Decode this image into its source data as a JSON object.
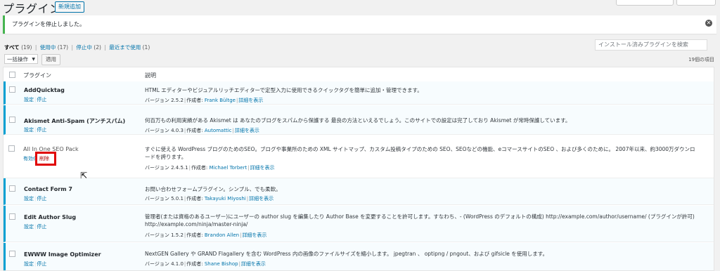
{
  "header": {
    "title": "プラグイン",
    "add_new": "新規追加"
  },
  "notice": {
    "message": "プラグインを停止しました。",
    "dismiss": "✕"
  },
  "filters": {
    "items": [
      {
        "label": "すべて",
        "count": "(19)"
      },
      {
        "label": "使用中",
        "count": "(17)"
      },
      {
        "label": "停止中",
        "count": "(2)"
      },
      {
        "label": "最近まで使用",
        "count": "(1)"
      }
    ],
    "sep": "|"
  },
  "search": {
    "placeholder": "インストール済みプラグインを検索"
  },
  "bulk": {
    "selected": "一括操作",
    "apply": "適用"
  },
  "item_count": "19個の項目",
  "table": {
    "col_plugin": "プラグイン",
    "col_desc": "説明",
    "rows": [
      {
        "name": "AddQuicktag",
        "actions": [
          "設定",
          "停止"
        ],
        "desc": "HTML エディターやビジュアルリッチエディターで定型入力に使用できるクイックタグを簡単に追加・管理できます。",
        "version": "バージョン 2.5.2",
        "author_label": "作成者:",
        "author": "Frank Bültge",
        "details": "詳細を表示"
      },
      {
        "name": "Akismet Anti-Spam (アンチスパム)",
        "actions": [
          "設定",
          "停止"
        ],
        "desc": "何百万もの利用実績がある Akismet は あなたのブログをスパムから保護する 最良の方法といえるでしょう。このサイトでの設定は完了しており Akismet が常時保護しています。",
        "version": "バージョン 4.0.3",
        "author_label": "作成者:",
        "author": "Automattic",
        "details": "詳細を表示"
      },
      {
        "name": "All In One SEO Pack",
        "actions": [
          "有効化",
          "削除"
        ],
        "desc": "すぐに使える WordPress ブログのためのSEO。ブログや事業所のための XML サイトマップ、カスタム投稿タイプのための SEO、SEOなどの機能、eコマースサイトのSEO 、および多くのために。 2007年以来、約3000万ダウンロードを誇ります。",
        "version": "バージョン 2.4.5.1",
        "author_label": "作成者:",
        "author": "Michael Torbert",
        "details": "詳細を表示"
      },
      {
        "name": "Contact Form 7",
        "actions": [
          "設定",
          "停止"
        ],
        "desc": "お問い合わせフォームプラグイン。シンプル、でも柔軟。",
        "version": "バージョン 5.0.1",
        "author_label": "作成者:",
        "author": "Takayuki Miyoshi",
        "details": "詳細を表示"
      },
      {
        "name": "Edit Author Slug",
        "actions": [
          "設定",
          "停止"
        ],
        "desc": "管理者(または資格のあるユーザー)にユーザーの author slug を編集したり Author Base を変更することを許可します。すなわち、- (WordPress のデフォルトの構成) http://example.com/author/username/ (プラグインが許可) http://example.com/ninja/master-ninja/",
        "version": "バージョン 1.5.2",
        "author_label": "作成者:",
        "author": "Brandon Allen",
        "details": "詳細を表示"
      },
      {
        "name": "EWWW Image Optimizer",
        "actions": [
          "設定",
          "停止"
        ],
        "desc": "NextGEN Gallery や GRAND Flagallery を含む WordPress 内の画像のファイルサイズを縮小します。 jpegtran 、 optipng / pngout、および gifsicle を使用します。",
        "version": "バージョン 4.1.0",
        "author_label": "作成者:",
        "author": "Shane Bishop",
        "details": "詳細を表示"
      }
    ]
  },
  "highlight_label": "削除",
  "cursor": "⇱"
}
